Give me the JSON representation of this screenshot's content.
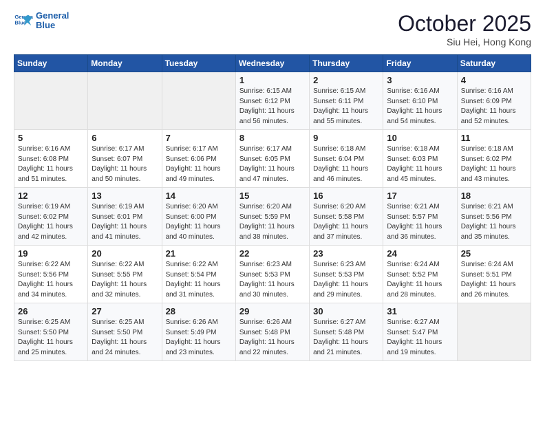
{
  "header": {
    "logo_line1": "General",
    "logo_line2": "Blue",
    "month": "October 2025",
    "location": "Siu Hei, Hong Kong"
  },
  "weekdays": [
    "Sunday",
    "Monday",
    "Tuesday",
    "Wednesday",
    "Thursday",
    "Friday",
    "Saturday"
  ],
  "weeks": [
    [
      {
        "day": null
      },
      {
        "day": null
      },
      {
        "day": null
      },
      {
        "day": "1",
        "sunrise": "6:15 AM",
        "sunset": "6:12 PM",
        "daylight": "11 hours and 56 minutes."
      },
      {
        "day": "2",
        "sunrise": "6:15 AM",
        "sunset": "6:11 PM",
        "daylight": "11 hours and 55 minutes."
      },
      {
        "day": "3",
        "sunrise": "6:16 AM",
        "sunset": "6:10 PM",
        "daylight": "11 hours and 54 minutes."
      },
      {
        "day": "4",
        "sunrise": "6:16 AM",
        "sunset": "6:09 PM",
        "daylight": "11 hours and 52 minutes."
      }
    ],
    [
      {
        "day": "5",
        "sunrise": "6:16 AM",
        "sunset": "6:08 PM",
        "daylight": "11 hours and 51 minutes."
      },
      {
        "day": "6",
        "sunrise": "6:17 AM",
        "sunset": "6:07 PM",
        "daylight": "11 hours and 50 minutes."
      },
      {
        "day": "7",
        "sunrise": "6:17 AM",
        "sunset": "6:06 PM",
        "daylight": "11 hours and 49 minutes."
      },
      {
        "day": "8",
        "sunrise": "6:17 AM",
        "sunset": "6:05 PM",
        "daylight": "11 hours and 47 minutes."
      },
      {
        "day": "9",
        "sunrise": "6:18 AM",
        "sunset": "6:04 PM",
        "daylight": "11 hours and 46 minutes."
      },
      {
        "day": "10",
        "sunrise": "6:18 AM",
        "sunset": "6:03 PM",
        "daylight": "11 hours and 45 minutes."
      },
      {
        "day": "11",
        "sunrise": "6:18 AM",
        "sunset": "6:02 PM",
        "daylight": "11 hours and 43 minutes."
      }
    ],
    [
      {
        "day": "12",
        "sunrise": "6:19 AM",
        "sunset": "6:02 PM",
        "daylight": "11 hours and 42 minutes."
      },
      {
        "day": "13",
        "sunrise": "6:19 AM",
        "sunset": "6:01 PM",
        "daylight": "11 hours and 41 minutes."
      },
      {
        "day": "14",
        "sunrise": "6:20 AM",
        "sunset": "6:00 PM",
        "daylight": "11 hours and 40 minutes."
      },
      {
        "day": "15",
        "sunrise": "6:20 AM",
        "sunset": "5:59 PM",
        "daylight": "11 hours and 38 minutes."
      },
      {
        "day": "16",
        "sunrise": "6:20 AM",
        "sunset": "5:58 PM",
        "daylight": "11 hours and 37 minutes."
      },
      {
        "day": "17",
        "sunrise": "6:21 AM",
        "sunset": "5:57 PM",
        "daylight": "11 hours and 36 minutes."
      },
      {
        "day": "18",
        "sunrise": "6:21 AM",
        "sunset": "5:56 PM",
        "daylight": "11 hours and 35 minutes."
      }
    ],
    [
      {
        "day": "19",
        "sunrise": "6:22 AM",
        "sunset": "5:56 PM",
        "daylight": "11 hours and 34 minutes."
      },
      {
        "day": "20",
        "sunrise": "6:22 AM",
        "sunset": "5:55 PM",
        "daylight": "11 hours and 32 minutes."
      },
      {
        "day": "21",
        "sunrise": "6:22 AM",
        "sunset": "5:54 PM",
        "daylight": "11 hours and 31 minutes."
      },
      {
        "day": "22",
        "sunrise": "6:23 AM",
        "sunset": "5:53 PM",
        "daylight": "11 hours and 30 minutes."
      },
      {
        "day": "23",
        "sunrise": "6:23 AM",
        "sunset": "5:53 PM",
        "daylight": "11 hours and 29 minutes."
      },
      {
        "day": "24",
        "sunrise": "6:24 AM",
        "sunset": "5:52 PM",
        "daylight": "11 hours and 28 minutes."
      },
      {
        "day": "25",
        "sunrise": "6:24 AM",
        "sunset": "5:51 PM",
        "daylight": "11 hours and 26 minutes."
      }
    ],
    [
      {
        "day": "26",
        "sunrise": "6:25 AM",
        "sunset": "5:50 PM",
        "daylight": "11 hours and 25 minutes."
      },
      {
        "day": "27",
        "sunrise": "6:25 AM",
        "sunset": "5:50 PM",
        "daylight": "11 hours and 24 minutes."
      },
      {
        "day": "28",
        "sunrise": "6:26 AM",
        "sunset": "5:49 PM",
        "daylight": "11 hours and 23 minutes."
      },
      {
        "day": "29",
        "sunrise": "6:26 AM",
        "sunset": "5:48 PM",
        "daylight": "11 hours and 22 minutes."
      },
      {
        "day": "30",
        "sunrise": "6:27 AM",
        "sunset": "5:48 PM",
        "daylight": "11 hours and 21 minutes."
      },
      {
        "day": "31",
        "sunrise": "6:27 AM",
        "sunset": "5:47 PM",
        "daylight": "11 hours and 19 minutes."
      },
      {
        "day": null
      }
    ]
  ],
  "labels": {
    "sunrise": "Sunrise:",
    "sunset": "Sunset:",
    "daylight": "Daylight:"
  }
}
